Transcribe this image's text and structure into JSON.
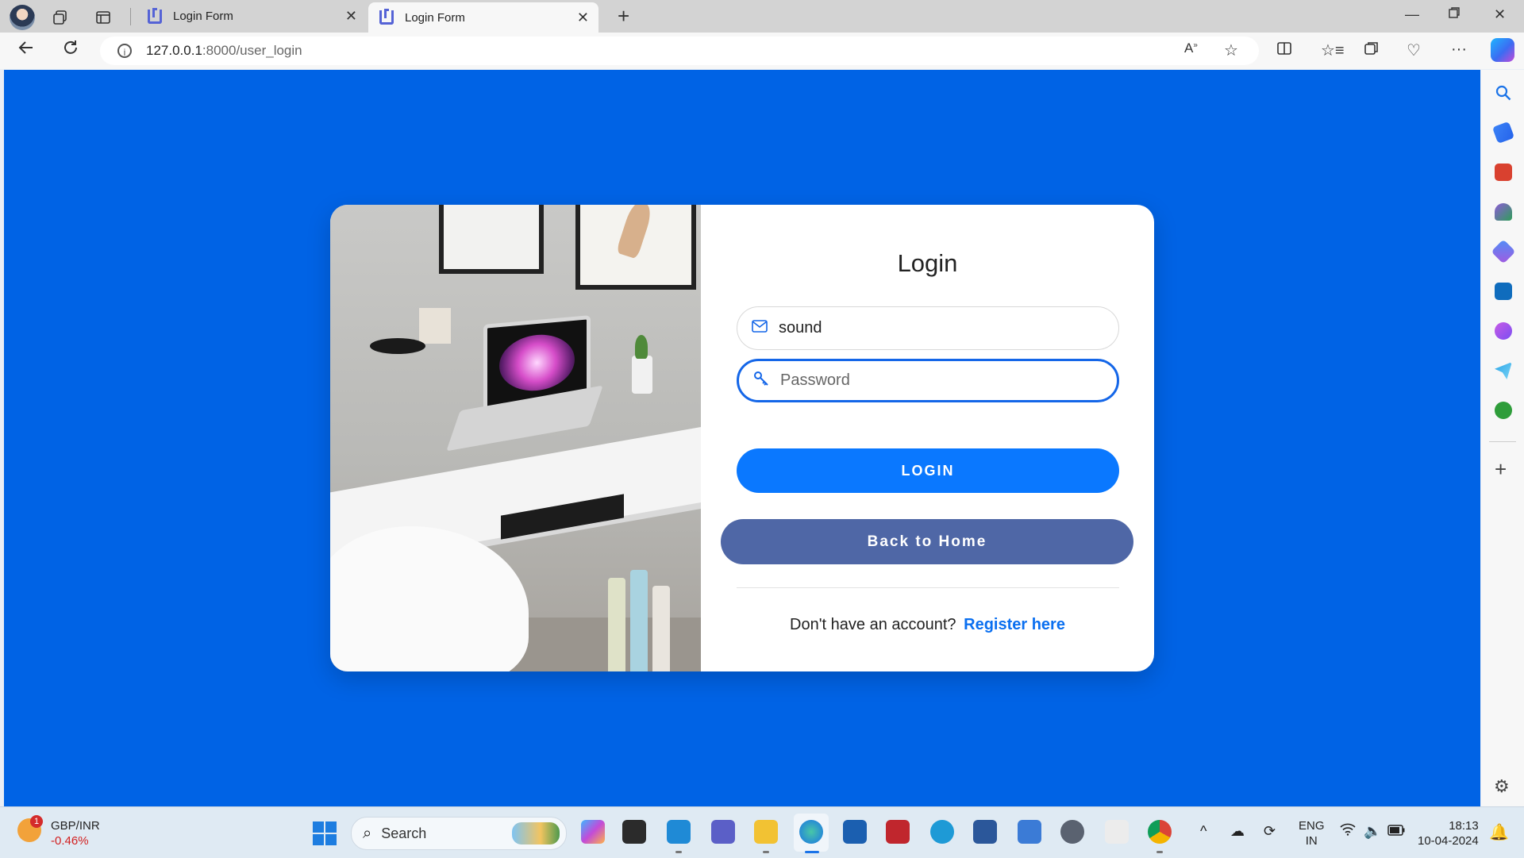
{
  "browser": {
    "tabs": [
      {
        "title": "Login Form",
        "active": false
      },
      {
        "title": "Login Form",
        "active": true
      }
    ],
    "address": {
      "host": "127.0.0.1",
      "path": ":8000/user_login"
    }
  },
  "login": {
    "title": "Login",
    "username_value": "sound",
    "password_placeholder": "Password",
    "login_button": "LOGIN",
    "back_button": "Back to Home",
    "register_prompt": "Don't have an account?",
    "register_link": "Register here"
  },
  "taskbar": {
    "ticker_name": "GBP/INR",
    "ticker_change": "-0.46%",
    "weather_badge": "1",
    "search_label": "Search",
    "lang_line1": "ENG",
    "lang_line2": "IN",
    "time": "18:13",
    "date": "10-04-2024"
  },
  "colors": {
    "page_background": "#0063e5",
    "login_button": "#0a78ff",
    "back_button": "#4f67a6",
    "link": "#0a6ff0"
  },
  "icons": {
    "username": "envelope-icon",
    "password": "key-icon"
  }
}
